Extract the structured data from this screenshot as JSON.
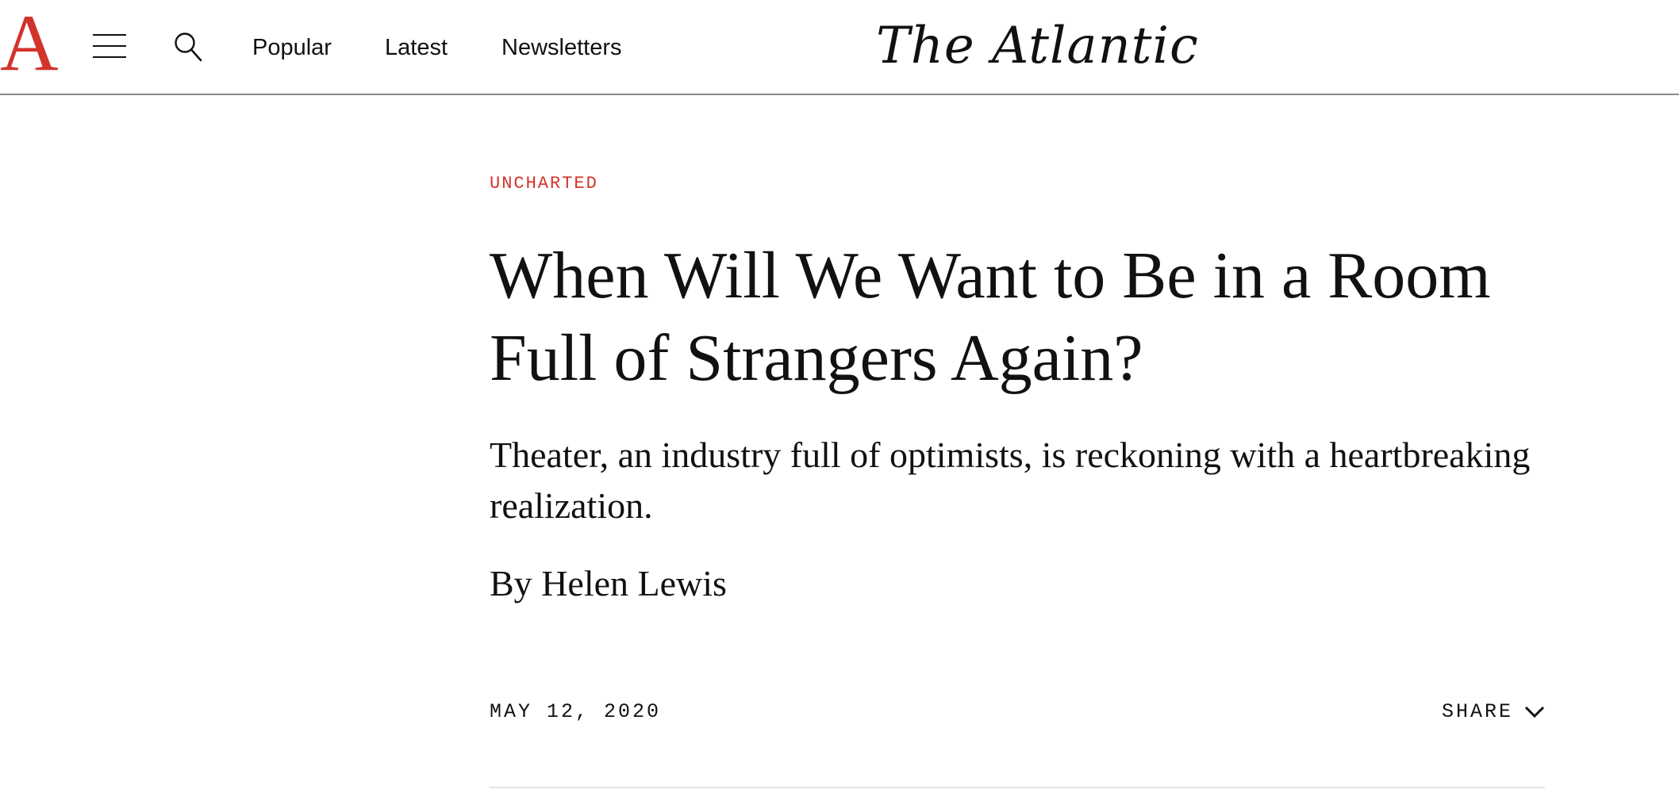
{
  "header": {
    "logo_letter": "A",
    "menu_icon": "hamburger-menu-icon",
    "search_icon": "search-icon",
    "nav": [
      {
        "label": "Popular"
      },
      {
        "label": "Latest"
      },
      {
        "label": "Newsletters"
      }
    ],
    "wordmark": "The Atlantic"
  },
  "article": {
    "section": "UNCHARTED",
    "headline": "When Will We Want to Be in a Room Full of Strangers Again?",
    "dek": "Theater, an industry full of optimists, is reckoning with a heartbreaking realization.",
    "byline_prefix": "By",
    "author": "Helen Lewis",
    "date": "MAY 12, 2020",
    "share_label": "SHARE",
    "share_icon": "chevron-down-icon"
  },
  "colors": {
    "brand_red": "#d2332c",
    "text": "#111111",
    "header_rule": "#8a8a8a",
    "divider": "#e3e3e3"
  }
}
